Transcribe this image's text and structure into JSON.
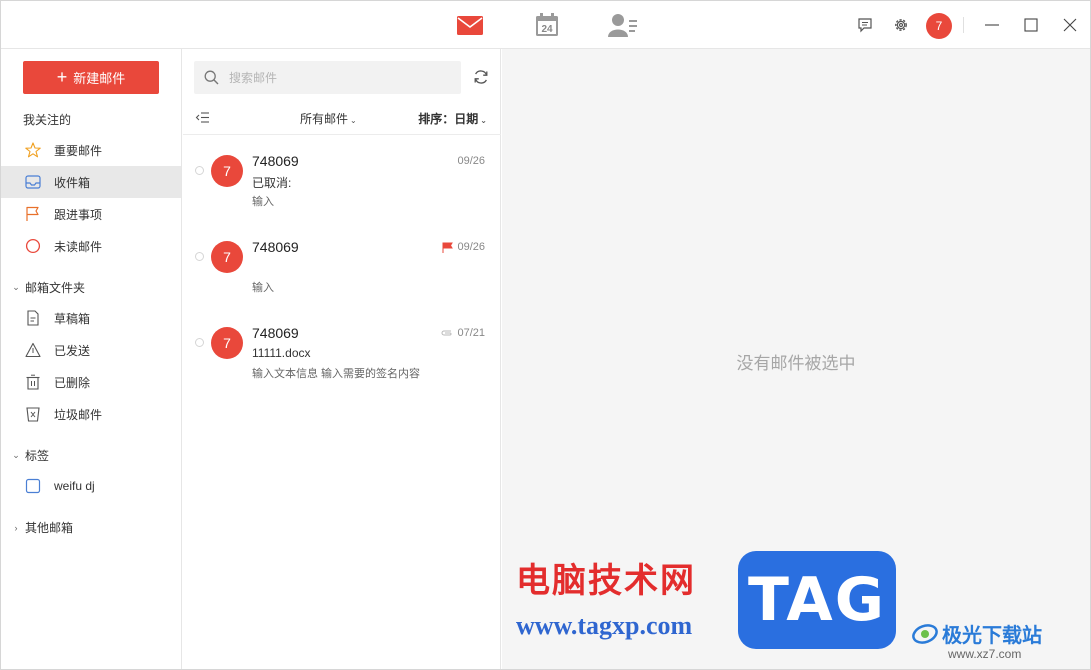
{
  "titlebar": {
    "apps": [
      {
        "name": "mail",
        "icon": "envelope-icon",
        "active": true
      },
      {
        "name": "calendar",
        "icon": "calendar-icon",
        "day": "24"
      },
      {
        "name": "contacts",
        "icon": "contacts-icon"
      }
    ],
    "avatar_text": "7",
    "accent": "#e9483b"
  },
  "sidebar": {
    "compose_label": "新建邮件",
    "favorites_header": "我关注的",
    "favorites": [
      {
        "label": "重要邮件",
        "icon": "star-icon"
      },
      {
        "label": "收件箱",
        "icon": "inbox-icon",
        "active": true
      },
      {
        "label": "跟进事项",
        "icon": "flag-icon"
      },
      {
        "label": "未读邮件",
        "icon": "unread-circle-icon"
      }
    ],
    "folders_header": "邮箱文件夹",
    "folders": [
      {
        "label": "草稿箱",
        "icon": "draft-icon"
      },
      {
        "label": "已发送",
        "icon": "sent-icon"
      },
      {
        "label": "已删除",
        "icon": "trash-icon"
      },
      {
        "label": "垃圾邮件",
        "icon": "spam-icon"
      }
    ],
    "tags_header": "标签",
    "tags": [
      {
        "label": "weifu dj",
        "icon": "tag-checkbox-icon"
      }
    ],
    "other_header": "其他邮箱"
  },
  "list": {
    "search_placeholder": "搜索邮件",
    "filter_label": "所有邮件",
    "sort_label": "排序：",
    "sort_value": "日期",
    "items": [
      {
        "avatar": "7",
        "sender": "748069",
        "subject": "已取消:",
        "preview": "输入",
        "date": "09/26",
        "flag": false,
        "attach": false
      },
      {
        "avatar": "7",
        "sender": "748069",
        "subject": "",
        "preview": "输入",
        "date": "09/26",
        "flag": true,
        "attach": false
      },
      {
        "avatar": "7",
        "sender": "748069",
        "subject": "11111.docx",
        "preview": "输入文本信息 输入需要的签名内容",
        "date": "07/21",
        "flag": false,
        "attach": true
      }
    ]
  },
  "reader": {
    "empty_text": "没有邮件被选中"
  },
  "watermark": {
    "cn_title": "电脑技术网",
    "url": "www.tagxp.com",
    "tag": "TAG",
    "site_cn": "极光下载站",
    "site_url": "www.xz7.com"
  }
}
